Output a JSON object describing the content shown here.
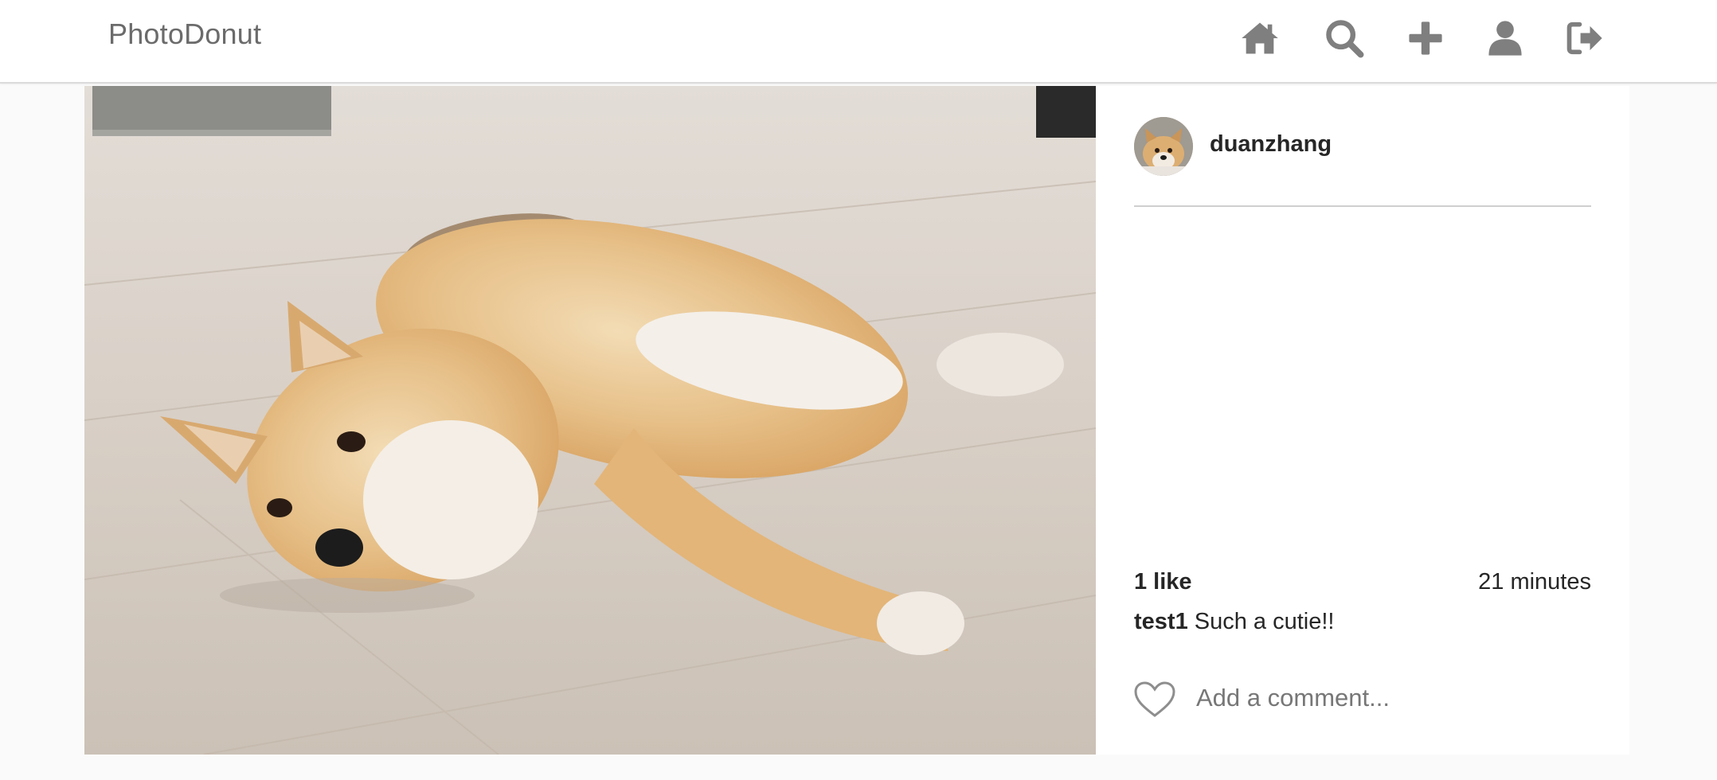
{
  "header": {
    "brand": "PhotoDonut",
    "nav_icons": [
      "home-icon",
      "search-icon",
      "plus-icon",
      "user-icon",
      "sign-out-icon"
    ]
  },
  "post": {
    "image_subject": "shiba-inu-dog-lying-on-floor",
    "author": {
      "username": "duanzhang",
      "avatar": "shiba-avatar"
    },
    "likes_text": "1 like",
    "time_text": "21 minutes",
    "comments": [
      {
        "author": "test1",
        "text": "Such a cutie!!"
      }
    ],
    "comment_placeholder": "Add a comment...",
    "like_icon": "heart-outline-icon"
  },
  "colors": {
    "background": "#fafafa",
    "header_bg": "#ffffff",
    "icon_gray": "#7f7f7f",
    "text": "#262626",
    "placeholder": "#777777"
  }
}
